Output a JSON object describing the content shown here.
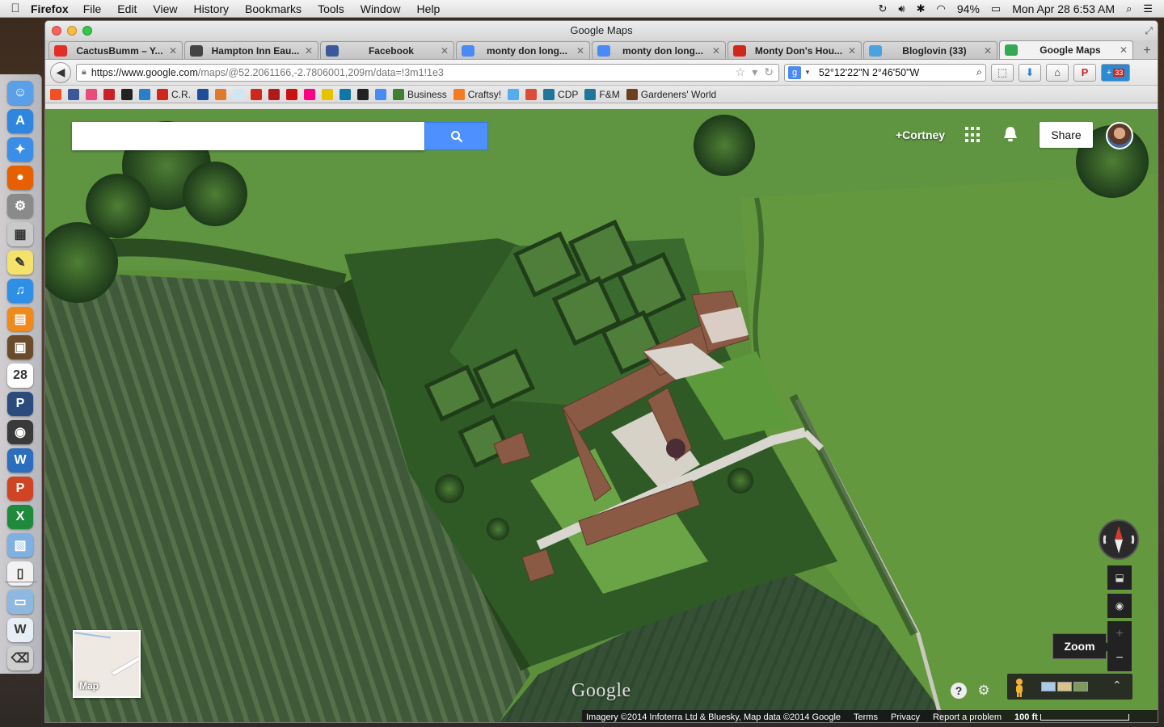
{
  "menubar": {
    "app_name": "Firefox",
    "items": [
      "File",
      "Edit",
      "View",
      "History",
      "Bookmarks",
      "Tools",
      "Window",
      "Help"
    ],
    "battery": "94%",
    "clock": "Mon Apr 28  6:53 AM"
  },
  "window": {
    "title": "Google Maps"
  },
  "tabs": [
    {
      "label": "CactusBumm – Y...",
      "favicon_color": "#e52d27",
      "favicon": "youtube-icon"
    },
    {
      "label": "Hampton Inn Eau...",
      "favicon_color": "#444444",
      "favicon": "tripadvisor-icon"
    },
    {
      "label": "Facebook",
      "favicon_color": "#3b5998",
      "favicon": "facebook-icon"
    },
    {
      "label": "monty don long...",
      "favicon_color": "#4a8af4",
      "favicon": "google-icon"
    },
    {
      "label": "monty don long...",
      "favicon_color": "#4a8af4",
      "favicon": "google-icon"
    },
    {
      "label": "Monty Don's Hou...",
      "favicon_color": "#d0271d",
      "favicon": "pinterest-icon"
    },
    {
      "label": "Bloglovin (33)",
      "favicon_color": "#4aa3df",
      "favicon": "bloglovin-icon"
    },
    {
      "label": "Google Maps",
      "favicon_color": "#34a853",
      "favicon": "maps-icon",
      "active": true
    }
  ],
  "navbar": {
    "url_host": "https://www.google.com",
    "url_rest": "/maps/@52.2061166,-2.7806001,209m/data=!3m1!1e3",
    "search_value": "52°12'22\"N  2°46'50\"W",
    "bloglovin_count": "33"
  },
  "bookmarks": [
    {
      "label": "",
      "color": "#f25022"
    },
    {
      "label": "",
      "color": "#3b5998"
    },
    {
      "label": "",
      "color": "#e94b7a"
    },
    {
      "label": "",
      "color": "#cb2027"
    },
    {
      "label": "",
      "color": "#222222"
    },
    {
      "label": "",
      "color": "#2a7fc9"
    },
    {
      "label": "C.R.",
      "color": "#d0271d"
    },
    {
      "label": "",
      "color": "#1e4e9a"
    },
    {
      "label": "",
      "color": "#e07a2b"
    },
    {
      "label": "",
      "color": "#cfe6f5"
    },
    {
      "label": "",
      "color": "#d0271d"
    },
    {
      "label": "",
      "color": "#b11a1a"
    },
    {
      "label": "",
      "color": "#cc1111"
    },
    {
      "label": "",
      "color": "#ff0084"
    },
    {
      "label": "",
      "color": "#e6c200"
    },
    {
      "label": "",
      "color": "#0e76a8"
    },
    {
      "label": "",
      "color": "#222222"
    },
    {
      "label": "",
      "color": "#4a8af4"
    },
    {
      "label": "Business",
      "color": "#3f7f2f"
    },
    {
      "label": "Craftsy!",
      "color": "#f47b20"
    },
    {
      "label": "",
      "color": "#55acee"
    },
    {
      "label": "",
      "color": "#dd4b39"
    },
    {
      "label": "CDP",
      "color": "#21759b"
    },
    {
      "label": "F&M",
      "color": "#21759b"
    },
    {
      "label": "Gardeners' World",
      "color": "#6b3f1f"
    }
  ],
  "maps": {
    "search_placeholder": "",
    "user_name": "+Cortney",
    "share_label": "Share",
    "minimap_label": "Map",
    "logo": "Google",
    "zoom_tooltip": "Zoom",
    "footer": {
      "imagery": "Imagery ©2014 Infoterra Ltd & Bluesky, Map data ©2014 Google",
      "terms": "Terms",
      "privacy": "Privacy",
      "report": "Report a problem",
      "scale": "100 ft"
    }
  },
  "dock": [
    {
      "name": "finder-icon",
      "color": "#5aa0e8",
      "glyph": "☺"
    },
    {
      "name": "app-store-icon",
      "color": "#2f86de",
      "glyph": "A"
    },
    {
      "name": "safari-icon",
      "color": "#3a8ee6",
      "glyph": "✦"
    },
    {
      "name": "firefox-icon",
      "color": "#e66000",
      "glyph": "●"
    },
    {
      "name": "system-preferences-icon",
      "color": "#8a8a8a",
      "glyph": "⚙"
    },
    {
      "name": "calculator-icon",
      "color": "#c9c9c9",
      "glyph": "▦"
    },
    {
      "name": "stickies-icon",
      "color": "#f5e26a",
      "glyph": "✎"
    },
    {
      "name": "itunes-icon",
      "color": "#2d8fe6",
      "glyph": "♫"
    },
    {
      "name": "ibooks-icon",
      "color": "#f08a1c",
      "glyph": "▤"
    },
    {
      "name": "iphoto-icon",
      "color": "#6a4b2a",
      "glyph": "▣"
    },
    {
      "name": "calendar-icon",
      "color": "#ffffff",
      "glyph": "28"
    },
    {
      "name": "pandora-icon",
      "color": "#2a4b7c",
      "glyph": "P"
    },
    {
      "name": "facetime-icon",
      "color": "#3a3a3a",
      "glyph": "◉"
    },
    {
      "name": "word-icon",
      "color": "#2a6ebd",
      "glyph": "W"
    },
    {
      "name": "powerpoint-icon",
      "color": "#d04423",
      "glyph": "P"
    },
    {
      "name": "excel-icon",
      "color": "#1f8a3c",
      "glyph": "X"
    },
    {
      "name": "preview-icon",
      "color": "#7fb0e0",
      "glyph": "▧"
    },
    {
      "name": "document-icon",
      "color": "#f2f2f2",
      "glyph": "▯"
    },
    {
      "name": "folder-icon",
      "color": "#8fb8e0",
      "glyph": "▭"
    },
    {
      "name": "word-doc-icon",
      "color": "#e8eef5",
      "glyph": "W"
    },
    {
      "name": "trash-icon",
      "color": "#cfcfcf",
      "glyph": "⌫"
    }
  ]
}
